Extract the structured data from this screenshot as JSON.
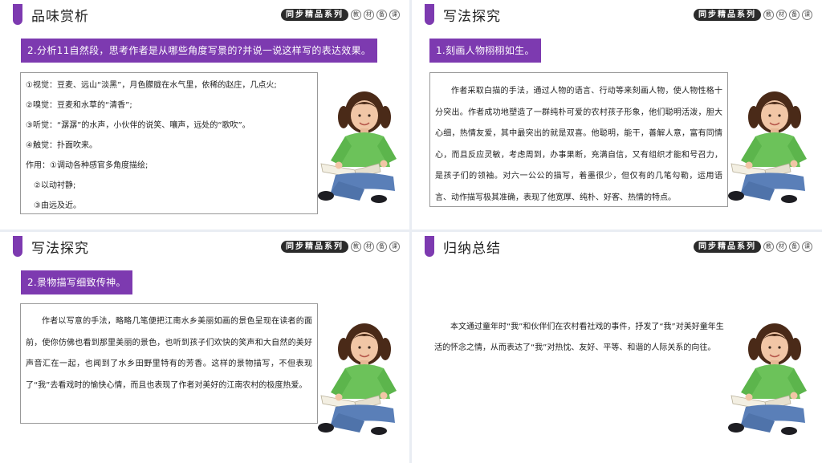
{
  "series_badge": "同步精品系列",
  "series_chars": [
    "教",
    "材",
    "备",
    "课"
  ],
  "slide1": {
    "title": "品味赏析",
    "question": "2.分析11自然段，思考作者是从哪些角度写景的?并说一说这样写的表达效果。",
    "lines": [
      "①视觉：豆麦、远山“淡黑”，月色朦胧在水气里，依稀的赵庄，几点火;",
      "②嗅觉：豆麦和水草的“清香”;",
      "③听觉：“潺潺”的水声，小伙伴的说笑、嚷声，远处的“歌吹”。",
      "④触觉：扑面吹来。",
      "作用：①调动各种感官多角度描绘;",
      "　②以动衬静;",
      "　③由远及近。"
    ]
  },
  "slide2": {
    "title": "写法探究",
    "tag": "1.刻画人物栩栩如生。",
    "paragraph": "作者采取白描的手法，通过人物的语言、行动等来刻画人物，使人物性格十分突出。作者成功地塑造了一群纯朴可爱的农村孩子形象，他们聪明活泼，胆大心细，热情友爱，其中最突出的就是双喜。他聪明，能干，善解人意，富有同情心，而且反应灵敏，考虑周到，办事果断，充满自信，又有组织才能和号召力，是孩子们的领袖。对六一公公的描写，着墨很少，但仅有的几笔勾勒，运用语言、动作描写极其准确，表现了他宽厚、纯朴、好客、热情的特点。"
  },
  "slide3": {
    "title": "写法探究",
    "tag": "2.景物描写细致传神。",
    "paragraph": "作者以写意的手法，略略几笔便把江南水乡美丽如画的景色呈现在读者的面前，使你仿佛也看到那里美丽的景色，也听到孩子们欢快的笑声和大自然的美好声音汇在一起，也闻到了水乡田野里特有的芳香。这样的景物描写，不但表现了“我”去看戏时的愉快心情，而且也表现了作者对美好的江南农村的极度热爱。"
  },
  "slide4": {
    "title": "归纳总结",
    "paragraph": "本文通过童年时“我”和伙伴们在农村看社戏的事件，抒发了“我”对美好童年生活的怀念之情，从而表达了“我”对热忱、友好、平等、和谐的人际关系的向往。"
  },
  "colors": {
    "accent": "#7d3ab0",
    "badge": "#2b2b2b"
  }
}
